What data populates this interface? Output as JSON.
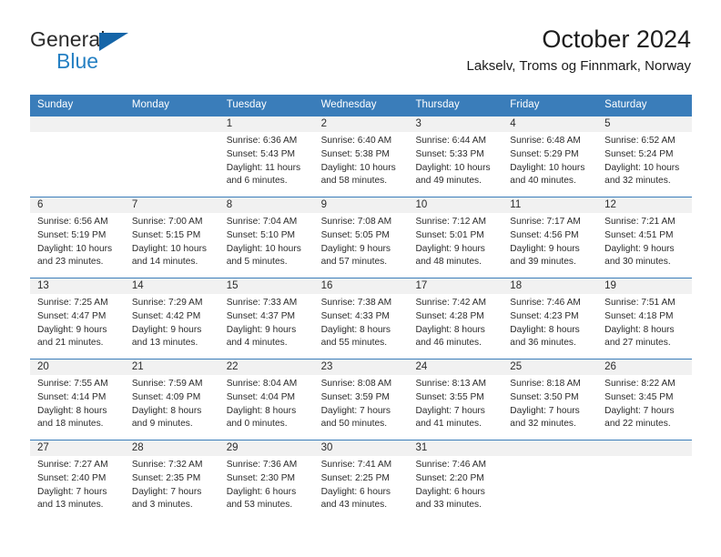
{
  "brand": {
    "name_primary": "General",
    "name_secondary": "Blue",
    "triangle_color": "#1565a8",
    "secondary_color": "#2580c3"
  },
  "header": {
    "month_title": "October 2024",
    "location": "Lakselv, Troms og Finnmark, Norway"
  },
  "colors": {
    "header_blue": "#3a7dba",
    "date_band_gray": "#f1f1f1",
    "text": "#2b2b2b"
  },
  "weekdays": [
    "Sunday",
    "Monday",
    "Tuesday",
    "Wednesday",
    "Thursday",
    "Friday",
    "Saturday"
  ],
  "weeks": [
    [
      {
        "day": "",
        "empty": true
      },
      {
        "day": "",
        "empty": true
      },
      {
        "day": "1",
        "sunrise": "Sunrise: 6:36 AM",
        "sunset": "Sunset: 5:43 PM",
        "daylight_1": "Daylight: 11 hours",
        "daylight_2": "and 6 minutes."
      },
      {
        "day": "2",
        "sunrise": "Sunrise: 6:40 AM",
        "sunset": "Sunset: 5:38 PM",
        "daylight_1": "Daylight: 10 hours",
        "daylight_2": "and 58 minutes."
      },
      {
        "day": "3",
        "sunrise": "Sunrise: 6:44 AM",
        "sunset": "Sunset: 5:33 PM",
        "daylight_1": "Daylight: 10 hours",
        "daylight_2": "and 49 minutes."
      },
      {
        "day": "4",
        "sunrise": "Sunrise: 6:48 AM",
        "sunset": "Sunset: 5:29 PM",
        "daylight_1": "Daylight: 10 hours",
        "daylight_2": "and 40 minutes."
      },
      {
        "day": "5",
        "sunrise": "Sunrise: 6:52 AM",
        "sunset": "Sunset: 5:24 PM",
        "daylight_1": "Daylight: 10 hours",
        "daylight_2": "and 32 minutes."
      }
    ],
    [
      {
        "day": "6",
        "sunrise": "Sunrise: 6:56 AM",
        "sunset": "Sunset: 5:19 PM",
        "daylight_1": "Daylight: 10 hours",
        "daylight_2": "and 23 minutes."
      },
      {
        "day": "7",
        "sunrise": "Sunrise: 7:00 AM",
        "sunset": "Sunset: 5:15 PM",
        "daylight_1": "Daylight: 10 hours",
        "daylight_2": "and 14 minutes."
      },
      {
        "day": "8",
        "sunrise": "Sunrise: 7:04 AM",
        "sunset": "Sunset: 5:10 PM",
        "daylight_1": "Daylight: 10 hours",
        "daylight_2": "and 5 minutes."
      },
      {
        "day": "9",
        "sunrise": "Sunrise: 7:08 AM",
        "sunset": "Sunset: 5:05 PM",
        "daylight_1": "Daylight: 9 hours",
        "daylight_2": "and 57 minutes."
      },
      {
        "day": "10",
        "sunrise": "Sunrise: 7:12 AM",
        "sunset": "Sunset: 5:01 PM",
        "daylight_1": "Daylight: 9 hours",
        "daylight_2": "and 48 minutes."
      },
      {
        "day": "11",
        "sunrise": "Sunrise: 7:17 AM",
        "sunset": "Sunset: 4:56 PM",
        "daylight_1": "Daylight: 9 hours",
        "daylight_2": "and 39 minutes."
      },
      {
        "day": "12",
        "sunrise": "Sunrise: 7:21 AM",
        "sunset": "Sunset: 4:51 PM",
        "daylight_1": "Daylight: 9 hours",
        "daylight_2": "and 30 minutes."
      }
    ],
    [
      {
        "day": "13",
        "sunrise": "Sunrise: 7:25 AM",
        "sunset": "Sunset: 4:47 PM",
        "daylight_1": "Daylight: 9 hours",
        "daylight_2": "and 21 minutes."
      },
      {
        "day": "14",
        "sunrise": "Sunrise: 7:29 AM",
        "sunset": "Sunset: 4:42 PM",
        "daylight_1": "Daylight: 9 hours",
        "daylight_2": "and 13 minutes."
      },
      {
        "day": "15",
        "sunrise": "Sunrise: 7:33 AM",
        "sunset": "Sunset: 4:37 PM",
        "daylight_1": "Daylight: 9 hours",
        "daylight_2": "and 4 minutes."
      },
      {
        "day": "16",
        "sunrise": "Sunrise: 7:38 AM",
        "sunset": "Sunset: 4:33 PM",
        "daylight_1": "Daylight: 8 hours",
        "daylight_2": "and 55 minutes."
      },
      {
        "day": "17",
        "sunrise": "Sunrise: 7:42 AM",
        "sunset": "Sunset: 4:28 PM",
        "daylight_1": "Daylight: 8 hours",
        "daylight_2": "and 46 minutes."
      },
      {
        "day": "18",
        "sunrise": "Sunrise: 7:46 AM",
        "sunset": "Sunset: 4:23 PM",
        "daylight_1": "Daylight: 8 hours",
        "daylight_2": "and 36 minutes."
      },
      {
        "day": "19",
        "sunrise": "Sunrise: 7:51 AM",
        "sunset": "Sunset: 4:18 PM",
        "daylight_1": "Daylight: 8 hours",
        "daylight_2": "and 27 minutes."
      }
    ],
    [
      {
        "day": "20",
        "sunrise": "Sunrise: 7:55 AM",
        "sunset": "Sunset: 4:14 PM",
        "daylight_1": "Daylight: 8 hours",
        "daylight_2": "and 18 minutes."
      },
      {
        "day": "21",
        "sunrise": "Sunrise: 7:59 AM",
        "sunset": "Sunset: 4:09 PM",
        "daylight_1": "Daylight: 8 hours",
        "daylight_2": "and 9 minutes."
      },
      {
        "day": "22",
        "sunrise": "Sunrise: 8:04 AM",
        "sunset": "Sunset: 4:04 PM",
        "daylight_1": "Daylight: 8 hours",
        "daylight_2": "and 0 minutes."
      },
      {
        "day": "23",
        "sunrise": "Sunrise: 8:08 AM",
        "sunset": "Sunset: 3:59 PM",
        "daylight_1": "Daylight: 7 hours",
        "daylight_2": "and 50 minutes."
      },
      {
        "day": "24",
        "sunrise": "Sunrise: 8:13 AM",
        "sunset": "Sunset: 3:55 PM",
        "daylight_1": "Daylight: 7 hours",
        "daylight_2": "and 41 minutes."
      },
      {
        "day": "25",
        "sunrise": "Sunrise: 8:18 AM",
        "sunset": "Sunset: 3:50 PM",
        "daylight_1": "Daylight: 7 hours",
        "daylight_2": "and 32 minutes."
      },
      {
        "day": "26",
        "sunrise": "Sunrise: 8:22 AM",
        "sunset": "Sunset: 3:45 PM",
        "daylight_1": "Daylight: 7 hours",
        "daylight_2": "and 22 minutes."
      }
    ],
    [
      {
        "day": "27",
        "sunrise": "Sunrise: 7:27 AM",
        "sunset": "Sunset: 2:40 PM",
        "daylight_1": "Daylight: 7 hours",
        "daylight_2": "and 13 minutes."
      },
      {
        "day": "28",
        "sunrise": "Sunrise: 7:32 AM",
        "sunset": "Sunset: 2:35 PM",
        "daylight_1": "Daylight: 7 hours",
        "daylight_2": "and 3 minutes."
      },
      {
        "day": "29",
        "sunrise": "Sunrise: 7:36 AM",
        "sunset": "Sunset: 2:30 PM",
        "daylight_1": "Daylight: 6 hours",
        "daylight_2": "and 53 minutes."
      },
      {
        "day": "30",
        "sunrise": "Sunrise: 7:41 AM",
        "sunset": "Sunset: 2:25 PM",
        "daylight_1": "Daylight: 6 hours",
        "daylight_2": "and 43 minutes."
      },
      {
        "day": "31",
        "sunrise": "Sunrise: 7:46 AM",
        "sunset": "Sunset: 2:20 PM",
        "daylight_1": "Daylight: 6 hours",
        "daylight_2": "and 33 minutes."
      },
      {
        "day": "",
        "empty": true
      },
      {
        "day": "",
        "empty": true
      }
    ]
  ]
}
